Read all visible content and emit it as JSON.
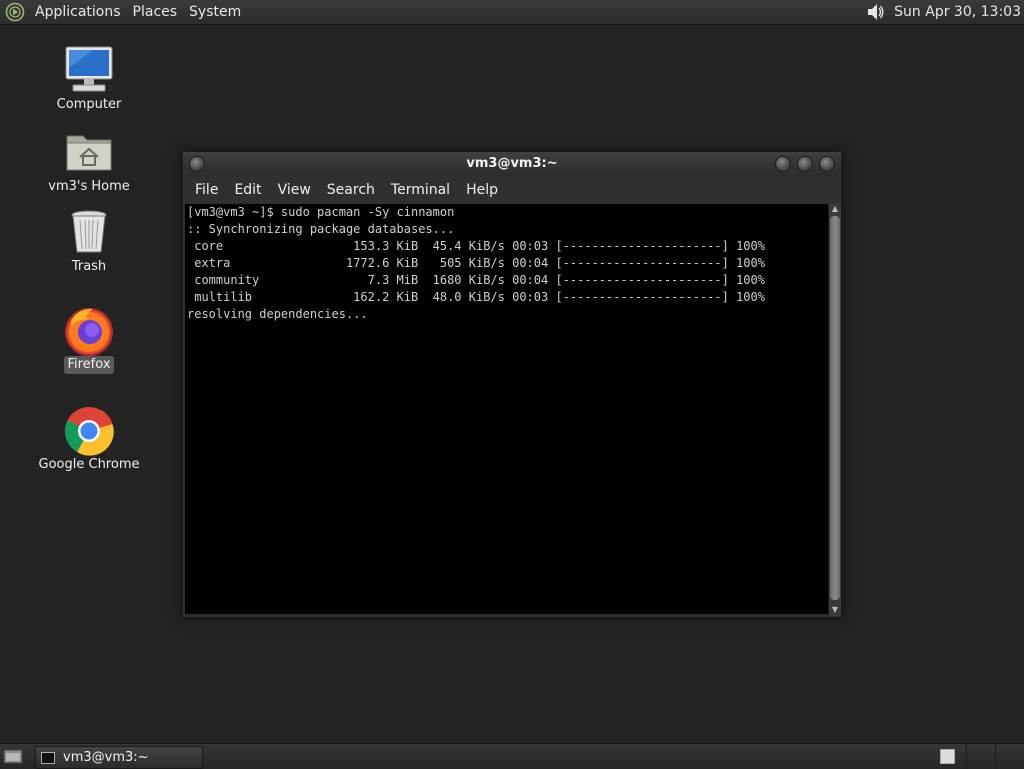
{
  "top_panel": {
    "menus": [
      "Applications",
      "Places",
      "System"
    ],
    "clock": "Sun Apr 30, 13:03"
  },
  "desktop": {
    "icons": [
      {
        "label": "Computer"
      },
      {
        "label": "vm3's Home"
      },
      {
        "label": "Trash"
      },
      {
        "label": "Firefox"
      },
      {
        "label": "Google Chrome"
      }
    ]
  },
  "window": {
    "title": "vm3@vm3:~",
    "menus": [
      "File",
      "Edit",
      "View",
      "Search",
      "Terminal",
      "Help"
    ],
    "terminal_lines": [
      "[vm3@vm3 ~]$ sudo pacman -Sy cinnamon",
      ":: Synchronizing package databases...",
      " core                  153.3 KiB  45.4 KiB/s 00:03 [----------------------] 100%",
      " extra                1772.6 KiB   505 KiB/s 00:04 [----------------------] 100%",
      " community               7.3 MiB  1680 KiB/s 00:04 [----------------------] 100%",
      " multilib              162.2 KiB  48.0 KiB/s 00:03 [----------------------] 100%",
      "resolving dependencies..."
    ]
  },
  "taskbar": {
    "tasks": [
      {
        "label": "vm3@vm3:~"
      }
    ]
  },
  "colors": {
    "desktop_bg": "#232323",
    "terminal_bg": "#000000",
    "terminal_fg": "#cfcfcf"
  }
}
